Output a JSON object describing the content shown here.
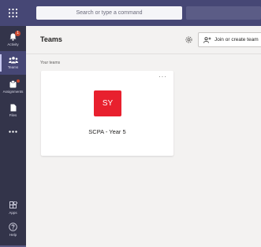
{
  "search": {
    "placeholder": "Search or type a command"
  },
  "rail": {
    "items": [
      {
        "label": "Activity",
        "icon": "bell-icon",
        "badge": "1"
      },
      {
        "label": "Teams",
        "icon": "teams-icon"
      },
      {
        "label": "Assignments",
        "icon": "assignments-icon"
      },
      {
        "label": "Files",
        "icon": "file-icon"
      },
      {
        "label": "",
        "icon": "more-icon"
      }
    ],
    "bottom": [
      {
        "label": "Apps",
        "icon": "apps-icon"
      },
      {
        "label": "Help",
        "icon": "help-icon"
      }
    ]
  },
  "header": {
    "title": "Teams",
    "join_label": "Join or create team",
    "settings_icon": "gear-icon"
  },
  "main": {
    "section_label": "Your teams",
    "teams": [
      {
        "initials": "SY",
        "name": "SCPA - Year 5",
        "color": "#e8202e"
      }
    ]
  },
  "colors": {
    "topbar": "#464775",
    "rail": "#33344a",
    "accent": "#6264a7"
  }
}
